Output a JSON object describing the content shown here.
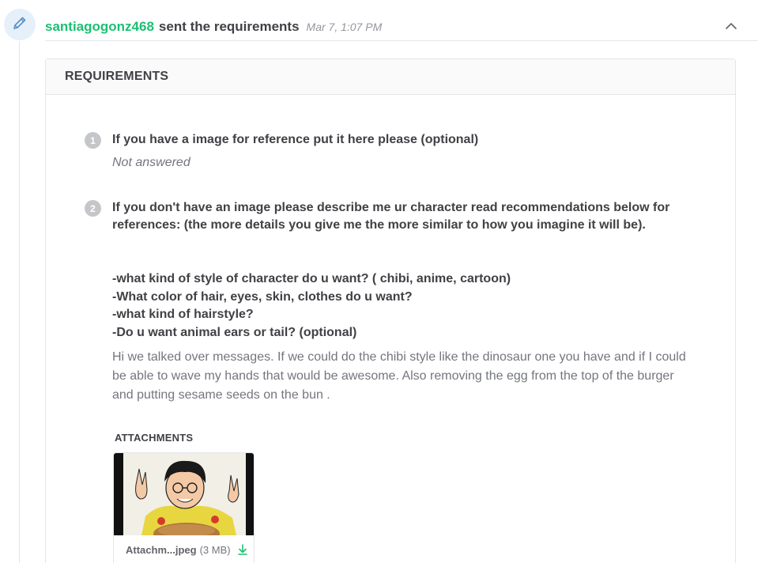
{
  "header": {
    "username": "santiagogonz468",
    "action": "sent the requirements",
    "timestamp": "Mar 7, 1:07 PM",
    "icon": "pencil-icon",
    "collapse_icon": "chevron-up-icon"
  },
  "requirements": {
    "title": "REQUIREMENTS",
    "questions": [
      {
        "number": "1",
        "text": "If you have a image for reference put it here please (optional)",
        "answer": "Not answered"
      },
      {
        "number": "2",
        "text": "If you don't have an image please describe me ur character read recommendations below for references: (the more details you give me the more similar to how you imagine it will be).",
        "list": [
          "-what kind of style of character do u want? ( chibi, anime, cartoon)",
          "-What color of hair, eyes, skin, clothes do u want?",
          "-what kind of hairstyle?",
          "-Do u want animal ears or tail? (optional)"
        ],
        "answer": "Hi we talked over messages. If we could do the chibi style like the dinosaur one you have and if I could be able to wave my hands that would be awesome. Also removing the egg from the top of the burger and putting sesame seeds on the bun ."
      }
    ]
  },
  "attachments": {
    "label": "ATTACHMENTS",
    "items": [
      {
        "name": "Attachm...jpeg",
        "size": "(3 MB)",
        "icon": "download-icon"
      }
    ]
  },
  "colors": {
    "brand_green": "#1dbf73",
    "text_dark": "#404145",
    "text_muted": "#74767e",
    "badge_bg": "#c5c6c9",
    "pencil_badge_bg": "#e6f0fa"
  }
}
